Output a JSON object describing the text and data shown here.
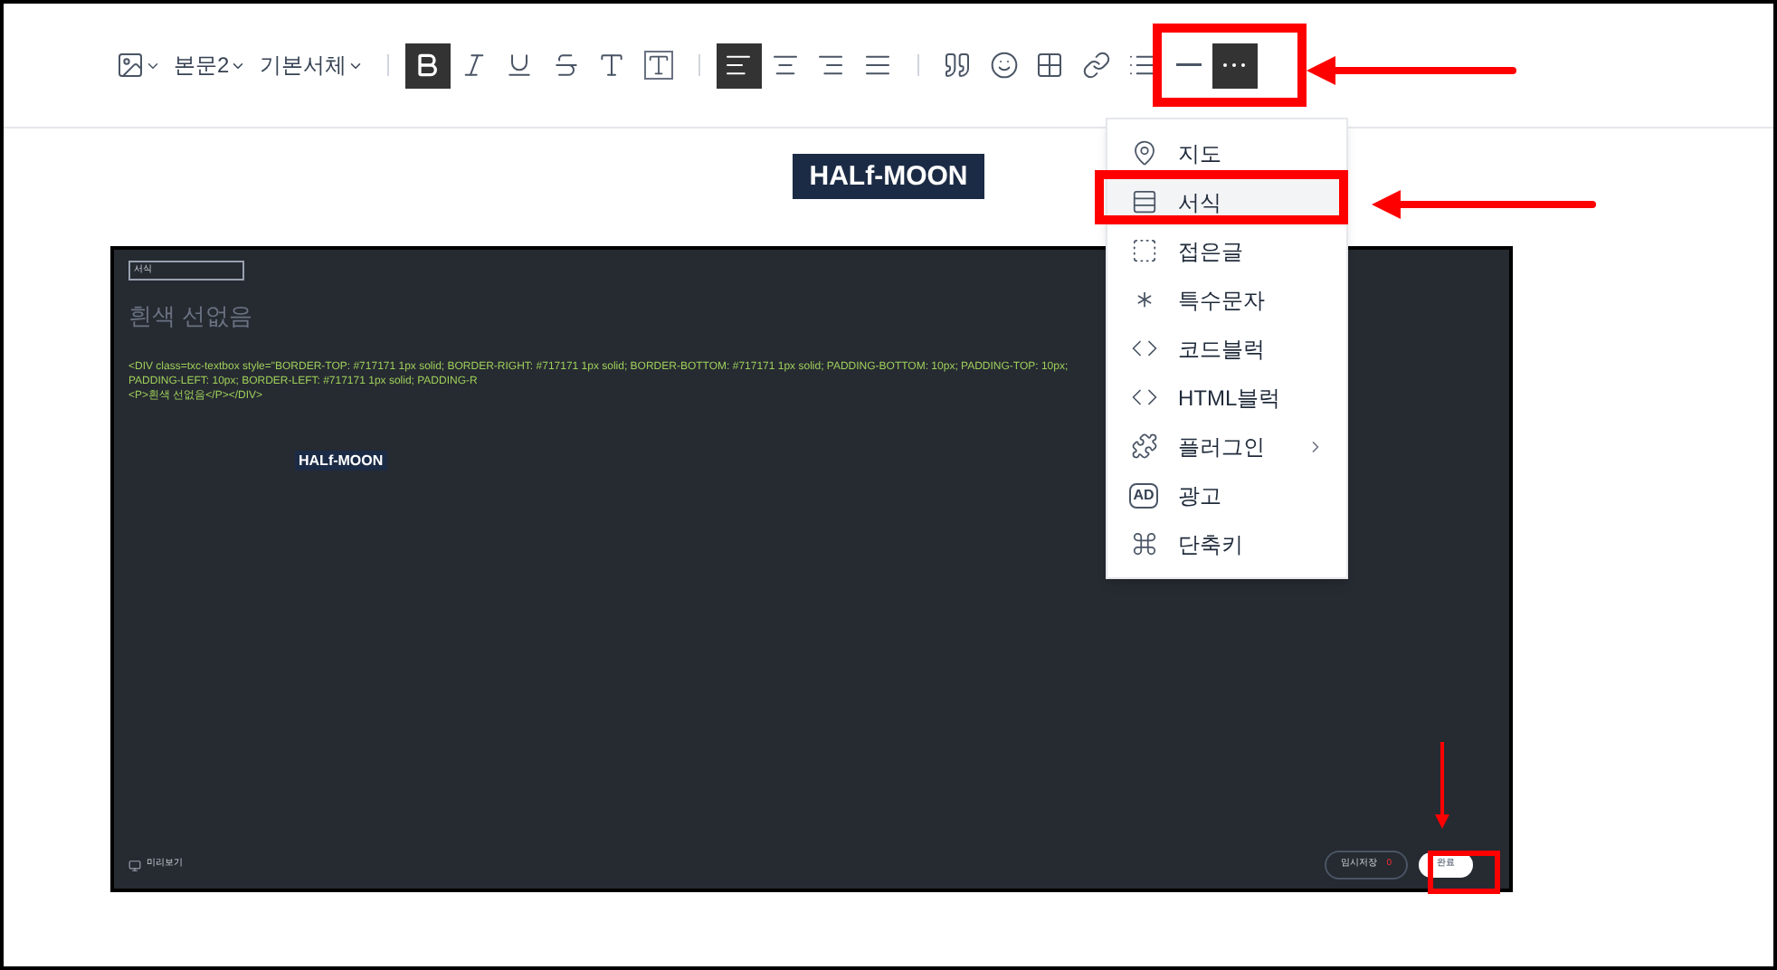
{
  "toolbar": [
    {
      "kind": "image",
      "selected": false
    },
    {
      "kind": "dropdown",
      "label": "본문2",
      "selected": false
    },
    {
      "kind": "dropdown",
      "label": "기본서체",
      "selected": false
    },
    {
      "kind": "separator"
    },
    {
      "kind": "bold",
      "selected": true
    },
    {
      "kind": "italic",
      "selected": false
    },
    {
      "kind": "underline",
      "selected": false
    },
    {
      "kind": "strike",
      "selected": false
    },
    {
      "kind": "textcolor",
      "selected": false
    },
    {
      "kind": "textbg",
      "selected": false
    },
    {
      "kind": "separator"
    },
    {
      "kind": "align-left",
      "selected": true
    },
    {
      "kind": "align-center",
      "selected": false
    },
    {
      "kind": "align-right",
      "selected": false
    },
    {
      "kind": "align-justify",
      "selected": false
    },
    {
      "kind": "separator"
    },
    {
      "kind": "quote",
      "selected": false
    },
    {
      "kind": "emoji",
      "selected": false
    },
    {
      "kind": "table",
      "selected": false
    },
    {
      "kind": "link",
      "selected": false
    },
    {
      "kind": "list",
      "selected": false
    },
    {
      "kind": "divider",
      "selected": false
    },
    {
      "kind": "more",
      "selected": true
    }
  ],
  "logo": "HALf-MOON",
  "menu": [
    {
      "kind": "map",
      "label": "지도",
      "selected": false
    },
    {
      "kind": "format",
      "label": "서식",
      "selected": true
    },
    {
      "kind": "fold",
      "label": "접은글",
      "selected": false
    },
    {
      "kind": "special",
      "label": "특수문자",
      "selected": false
    },
    {
      "kind": "code",
      "label": "코드블럭",
      "selected": false
    },
    {
      "kind": "code",
      "label": "HTML블럭",
      "selected": false
    },
    {
      "kind": "plugin",
      "label": "플러그인",
      "selected": false,
      "submenu": true
    },
    {
      "kind": "ad",
      "label": "광고",
      "badge": "AD",
      "selected": false
    },
    {
      "kind": "shortcut",
      "label": "단축키",
      "selected": false
    }
  ],
  "screenshot": {
    "field": "서식",
    "heading": "흰색 선없음",
    "code_lines": [
      "<DIV class=txc-textbox style=\"BORDER-TOP: #717171 1px solid; BORDER-RIGHT: #717171 1px solid; BORDER-BOTTOM: #717171 1px solid; PADDING-BOTTOM: 10px; PADDING-TOP: 10px; PADDING-LEFT: 10px; BORDER-LEFT: #717171 1px solid; PADDING-R",
      "<P>흰색 선없음</P></DIV>"
    ],
    "logo": "HALf-MOON",
    "preview": "미리보기",
    "save": "임시저장",
    "save_count": "0",
    "done": "완료"
  }
}
